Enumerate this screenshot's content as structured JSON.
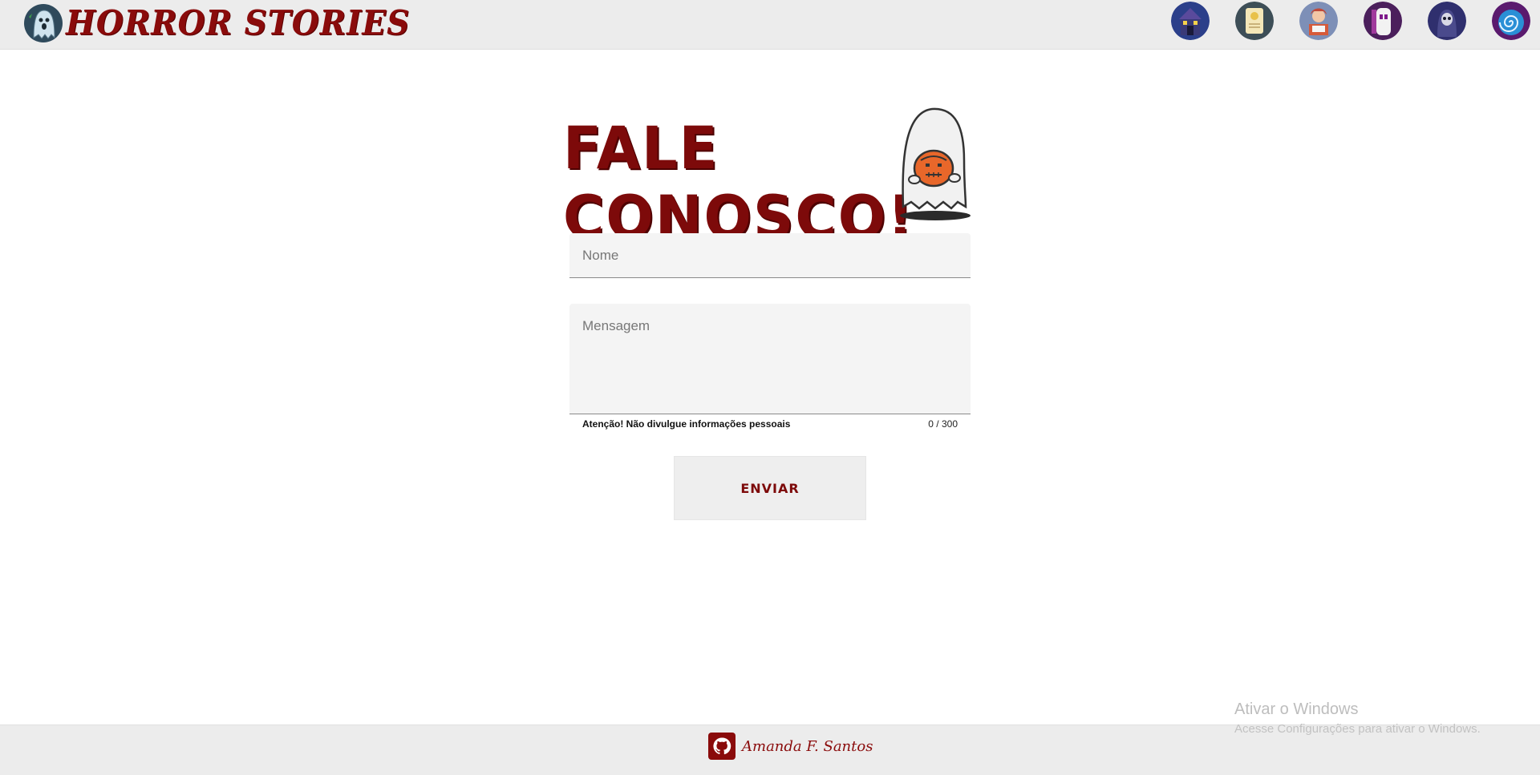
{
  "header": {
    "brand": "HORROR STORIES",
    "nav_icons": [
      "haunted-house-icon",
      "scroll-icon",
      "reader-icon",
      "masked-figure-icon",
      "grim-reaper-icon",
      "spiral-icon"
    ]
  },
  "main": {
    "title": "FALE CONOSCO!",
    "name_placeholder": "Nome",
    "name_value": "",
    "message_placeholder": "Mensagem",
    "message_value": "",
    "hint": "Atenção! Não divulgue informações pessoais",
    "counter": "0 / 300",
    "send_label": "ENVIAR"
  },
  "footer": {
    "author": "Amanda F. Santos"
  },
  "system": {
    "watermark_title": "Ativar o Windows",
    "watermark_sub": "Acesse Configurações para ativar o Windows."
  },
  "colors": {
    "brand": "#8a0b0b",
    "header_bg": "#ececec",
    "field_bg": "#f4f4f4"
  }
}
